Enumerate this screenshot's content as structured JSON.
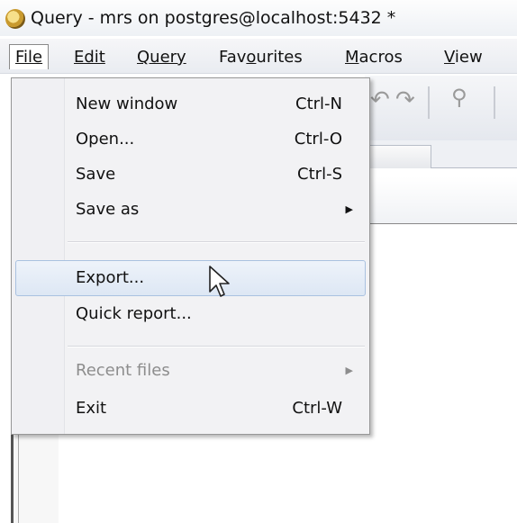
{
  "window": {
    "title": "Query - mrs on postgres@localhost:5432 *"
  },
  "menubar": {
    "file": "File",
    "edit": "Edit",
    "query": "Query",
    "favourites_pre": "Fav",
    "favourites_ul": "o",
    "favourites_post": "urites",
    "macros_ul": "M",
    "macros_post": "acros",
    "view_ul": "V",
    "view_post": "iew"
  },
  "file_menu": {
    "items": [
      {
        "label": "New window",
        "shortcut": "Ctrl-N"
      },
      {
        "label": "Open...",
        "shortcut": "Ctrl-O"
      },
      {
        "label": "Save",
        "shortcut": "Ctrl-S"
      },
      {
        "label": "Save as",
        "submenu": true
      },
      {
        "label": "Export...",
        "highlighted": true
      },
      {
        "label": "Quick report..."
      },
      {
        "label": "Recent files",
        "submenu": true,
        "disabled": true
      },
      {
        "label": "Exit",
        "shortcut": "Ctrl-W"
      }
    ]
  },
  "colors": {
    "highlight": "#dde7f4",
    "highlight_border": "#a9c1e0",
    "disabled_text": "#8d8d8d"
  }
}
